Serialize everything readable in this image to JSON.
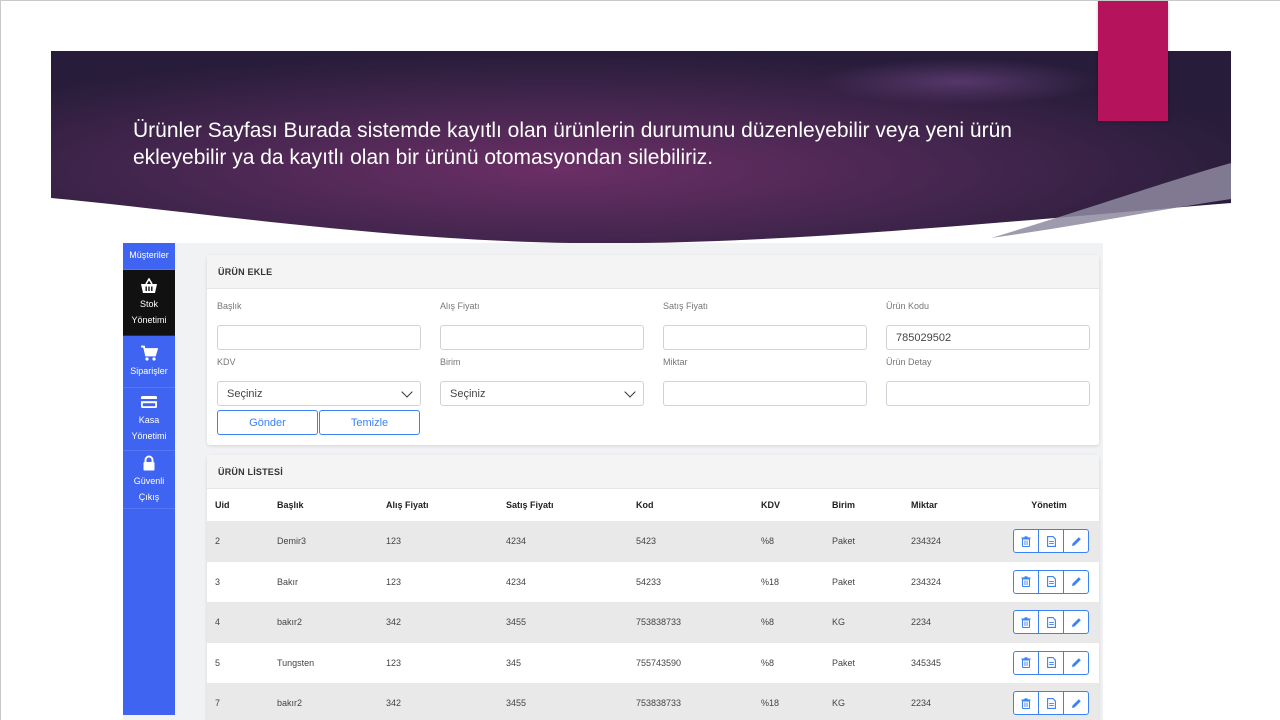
{
  "banner": {
    "text": "Ürünler Sayfası Burada sistemde kayıtlı olan ürünlerin durumunu düzenleyebilir veya yeni ürün ekleyebilir ya da kayıtlı olan bir ürünü otomasyondan silebiliriz.",
    "accent_color": "#b5135b"
  },
  "sidebar": {
    "items": [
      {
        "label": "Müşteriler",
        "icon": "users-icon"
      },
      {
        "label": "Stok Yönetimi",
        "icon": "basket-icon"
      },
      {
        "label": "Siparişler",
        "icon": "cart-icon"
      },
      {
        "label": "Kasa Yönetimi",
        "icon": "credit-card-icon"
      },
      {
        "label": "Güvenli Çıkış",
        "icon": "lock-icon"
      }
    ],
    "color": "#3f64f2"
  },
  "form": {
    "title": "ÜRÜN EKLE",
    "fields": [
      {
        "label": "Başlık",
        "value": ""
      },
      {
        "label": "Alış Fiyatı",
        "value": ""
      },
      {
        "label": "Satış Fiyatı",
        "value": ""
      },
      {
        "label": "Ürün Kodu",
        "value": "785029502"
      },
      {
        "label": "KDV",
        "value": "Seçiniz"
      },
      {
        "label": "Birim",
        "value": "Seçiniz"
      },
      {
        "label": "Miktar",
        "value": ""
      },
      {
        "label": "Ürün Detay",
        "value": ""
      }
    ],
    "submit_label": "Gönder",
    "clear_label": "Temizle"
  },
  "list": {
    "title": "ÜRÜN LİSTESİ",
    "columns": [
      "Uid",
      "Başlık",
      "Alış Fiyatı",
      "Satış Fiyatı",
      "Kod",
      "KDV",
      "Birim",
      "Miktar",
      "Yönetim"
    ],
    "rows": [
      [
        "2",
        "Demir3",
        "123",
        "4234",
        "5423",
        "%8",
        "Paket",
        "234324"
      ],
      [
        "3",
        "Bakır",
        "123",
        "4234",
        "54233",
        "%18",
        "Paket",
        "234324"
      ],
      [
        "4",
        "bakır2",
        "342",
        "3455",
        "753838733",
        "%8",
        "KG",
        "2234"
      ],
      [
        "5",
        "Tungsten",
        "123",
        "345",
        "755743590",
        "%8",
        "Paket",
        "345345"
      ],
      [
        "7",
        "bakır2",
        "342",
        "3455",
        "753838733",
        "%18",
        "KG",
        "2234"
      ]
    ],
    "row_actions": [
      "trash-icon",
      "document-icon",
      "pencil-icon"
    ]
  }
}
